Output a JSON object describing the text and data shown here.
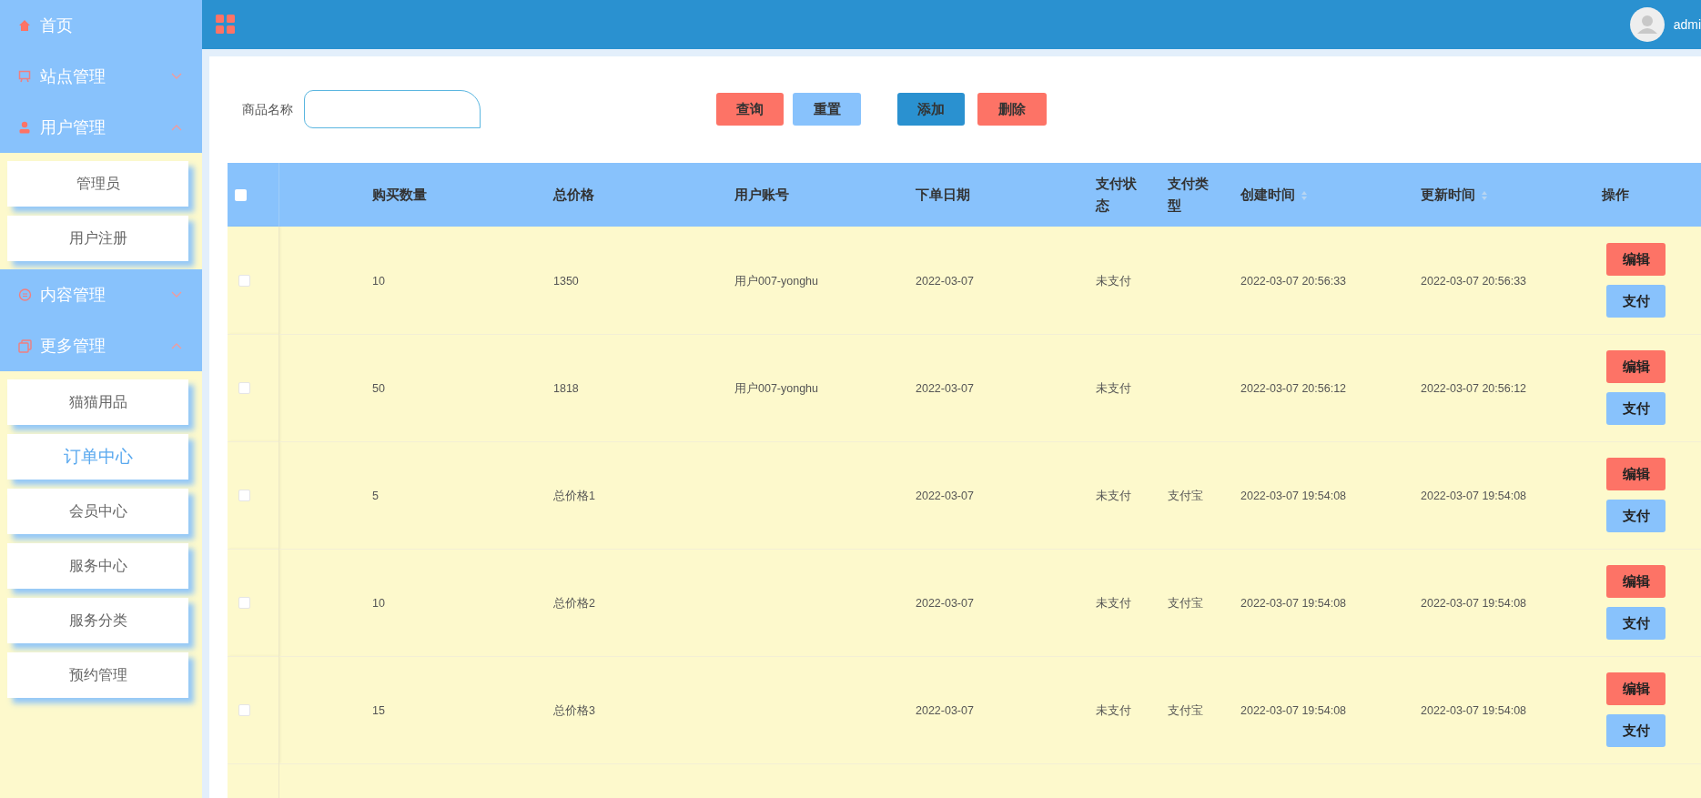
{
  "sidebar": {
    "menu": [
      {
        "kind": "link",
        "label": "首页"
      },
      {
        "kind": "group",
        "label": "站点管理",
        "expanded": false
      },
      {
        "kind": "group",
        "label": "用户管理",
        "expanded": true,
        "children": [
          {
            "label": "管理员",
            "selected": false
          },
          {
            "label": "用户注册",
            "selected": false
          }
        ]
      },
      {
        "kind": "group",
        "label": "内容管理",
        "expanded": false
      },
      {
        "kind": "group",
        "label": "更多管理",
        "expanded": true,
        "children": [
          {
            "label": "猫猫用品",
            "selected": false
          },
          {
            "label": "订单中心",
            "selected": true
          },
          {
            "label": "会员中心",
            "selected": false
          },
          {
            "label": "服务中心",
            "selected": false
          },
          {
            "label": "服务分类",
            "selected": false
          },
          {
            "label": "预约管理",
            "selected": false
          }
        ]
      }
    ]
  },
  "header": {
    "user": "admi"
  },
  "search": {
    "label": "商品名称",
    "buttons": [
      "查询",
      "重置",
      "添加",
      "删除"
    ]
  },
  "table": {
    "columns": [
      {
        "label": "购买数量",
        "sortable": false
      },
      {
        "label": "总价格",
        "sortable": false
      },
      {
        "label": "用户账号",
        "sortable": false
      },
      {
        "label": "下单日期",
        "sortable": false
      },
      {
        "label": "支付状态",
        "sortable": false
      },
      {
        "label": "支付类型",
        "sortable": false
      },
      {
        "label": "创建时间",
        "sortable": true
      },
      {
        "label": "更新时间",
        "sortable": true
      },
      {
        "label": "操作",
        "sortable": false
      }
    ],
    "rows": [
      {
        "checked": false,
        "cells": [
          "10",
          "1350",
          "用户007-yonghu",
          "2022-03-07",
          "未支付",
          "",
          "2022-03-07 20:56:33",
          "2022-03-07 20:56:33"
        ],
        "actions": [
          "编辑",
          "支付"
        ]
      },
      {
        "checked": false,
        "cells": [
          "50",
          "1818",
          "用户007-yonghu",
          "2022-03-07",
          "未支付",
          "",
          "2022-03-07 20:56:12",
          "2022-03-07 20:56:12"
        ],
        "actions": [
          "编辑",
          "支付"
        ]
      },
      {
        "checked": false,
        "cells": [
          "5",
          "总价格1",
          "",
          "2022-03-07",
          "未支付",
          "支付宝",
          "2022-03-07 19:54:08",
          "2022-03-07 19:54:08"
        ],
        "actions": [
          "编辑",
          "支付"
        ]
      },
      {
        "checked": false,
        "cells": [
          "10",
          "总价格2",
          "",
          "2022-03-07",
          "未支付",
          "支付宝",
          "2022-03-07 19:54:08",
          "2022-03-07 19:54:08"
        ],
        "actions": [
          "编辑",
          "支付"
        ]
      },
      {
        "checked": false,
        "cells": [
          "15",
          "总价格3",
          "",
          "2022-03-07",
          "未支付",
          "支付宝",
          "2022-03-07 19:54:08",
          "2022-03-07 19:54:08"
        ],
        "actions": [
          "编辑",
          "支付"
        ]
      }
    ],
    "all_checked": false
  }
}
